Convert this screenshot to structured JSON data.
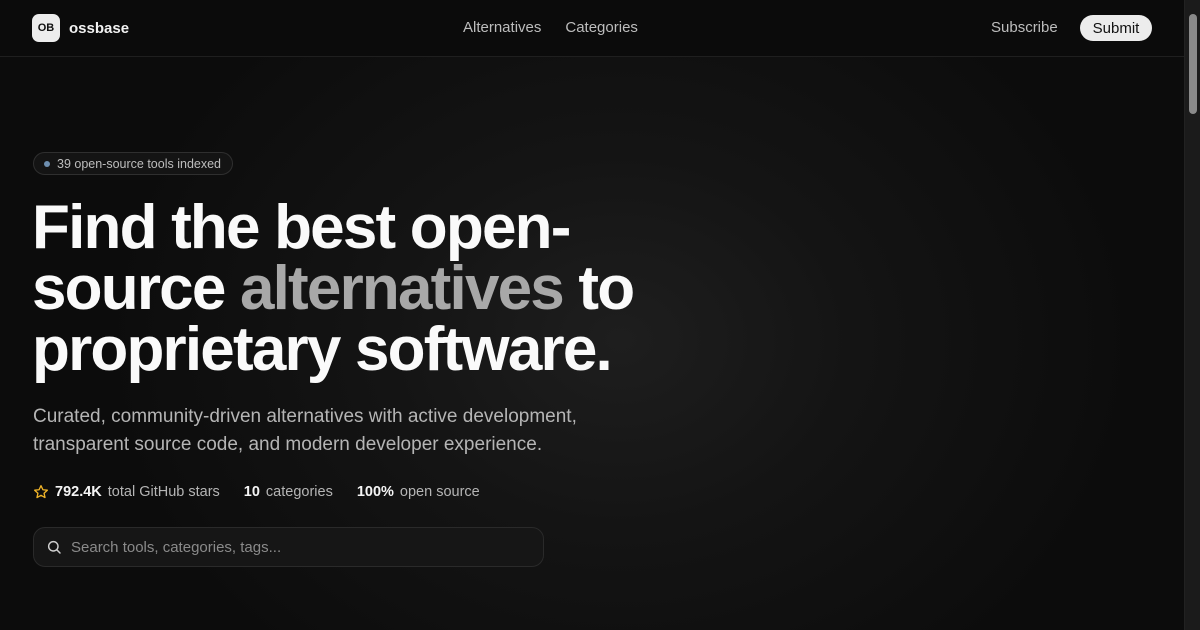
{
  "header": {
    "logo_badge": "OB",
    "logo_text": "ossbase",
    "nav": [
      "Alternatives",
      "Categories"
    ],
    "subscribe_label": "Subscribe",
    "submit_label": "Submit"
  },
  "hero": {
    "pill_text": "39 open-source tools indexed",
    "headline_part1": "Find the best open-source ",
    "headline_highlight": "alternatives",
    "headline_part2": " to proprietary software.",
    "subtitle": "Curated, community-driven alternatives with active development, transparent source code, and modern developer experience.",
    "stats": [
      {
        "value": "792.4K",
        "label": "total GitHub stars",
        "icon": "star-icon"
      },
      {
        "value": "10",
        "label": "categories"
      },
      {
        "value": "100%",
        "label": "open source"
      }
    ]
  },
  "search": {
    "placeholder": "Search tools, categories, tags...",
    "value": ""
  },
  "colors": {
    "background": "#0b0b0b",
    "accent_star": "#f0b429",
    "highlight_text": "#a8a8a8",
    "pill_dot": "#6e8fb0"
  }
}
